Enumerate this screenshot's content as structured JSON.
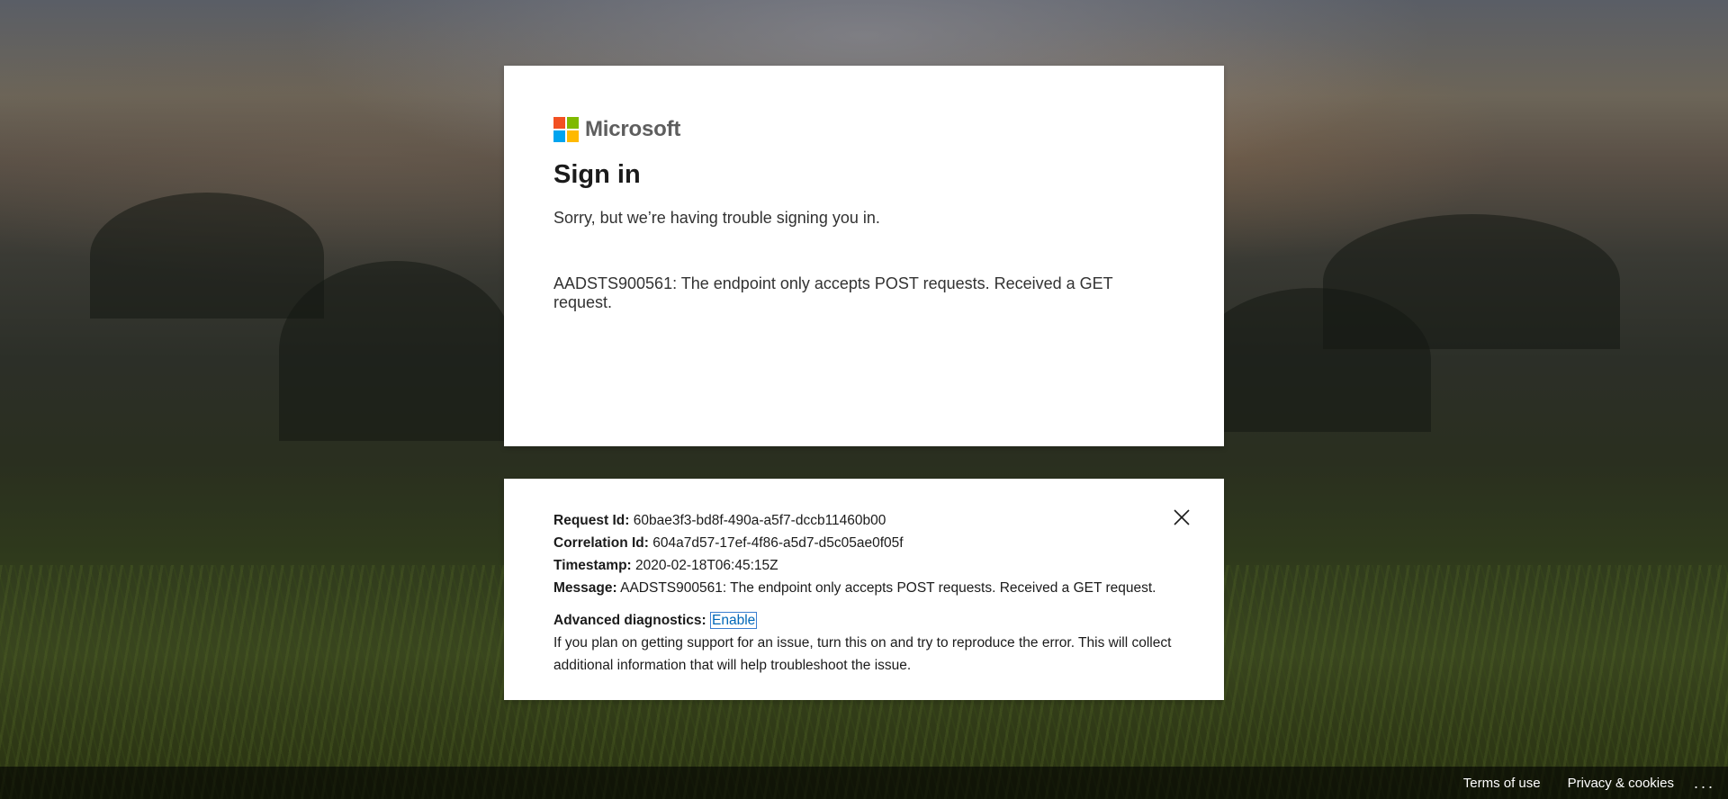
{
  "logo": {
    "text": "Microsoft",
    "colors": [
      "#f25022",
      "#7fba00",
      "#00a4ef",
      "#ffb900"
    ]
  },
  "main": {
    "title": "Sign in",
    "subtitle": "Sorry, but we’re having trouble signing you in.",
    "error": "AADSTS900561: The endpoint only accepts POST requests. Received a GET request."
  },
  "details": {
    "request_id_label": "Request Id:",
    "request_id": "60bae3f3-bd8f-490a-a5f7-dccb11460b00",
    "correlation_id_label": "Correlation Id:",
    "correlation_id": "604a7d57-17ef-4f86-a5d7-d5c05ae0f05f",
    "timestamp_label": "Timestamp:",
    "timestamp": "2020-02-18T06:45:15Z",
    "message_label": "Message:",
    "message": "AADSTS900561: The endpoint only accepts POST requests. Received a GET request.",
    "advanced_label": "Advanced diagnostics:",
    "enable_label": "Enable",
    "advanced_description": "If you plan on getting support for an issue, turn this on and try to reproduce the error. This will collect additional information that will help troubleshoot the issue.",
    "close_icon": "close-icon"
  },
  "footer": {
    "terms": "Terms of use",
    "privacy": "Privacy & cookies",
    "more": "..."
  }
}
